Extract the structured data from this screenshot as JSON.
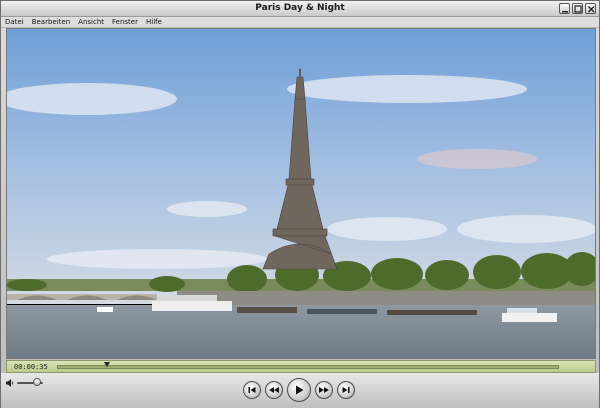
{
  "window": {
    "title": "Paris Day & Night",
    "buttons": [
      {
        "name": "minimize",
        "icon": "minimize-icon"
      },
      {
        "name": "maximize",
        "icon": "maximize-icon"
      },
      {
        "name": "close",
        "icon": "close-icon"
      }
    ]
  },
  "menu": {
    "items": [
      "Datei",
      "Bearbeiten",
      "Ansicht",
      "Fenster",
      "Hilfe"
    ]
  },
  "player": {
    "timecode": "00:00:35",
    "progress_percent": 10,
    "volume_percent": 75,
    "icons": {
      "volume": "speaker-icon",
      "skip_back": "skip-to-start-icon",
      "rewind": "rewind-icon",
      "play": "play-icon",
      "fast_forward": "fast-forward-icon",
      "skip_forward": "skip-to-end-icon"
    }
  },
  "colors": {
    "sky_top": "#6f9fd8",
    "sky_bottom": "#c7d6e8",
    "river": "#7f8c98",
    "trees": "#4d6b2a",
    "scrubber": "#c9d59e"
  }
}
